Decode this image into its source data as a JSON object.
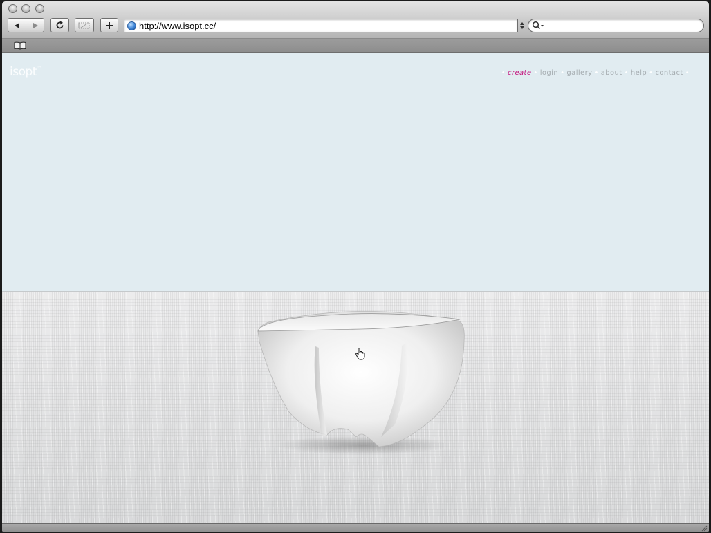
{
  "browser": {
    "url": "http://www.isopt.cc/",
    "icons": {
      "back": "back-arrow-icon",
      "forward": "forward-arrow-icon",
      "reload": "reload-icon",
      "snippet": "web-clip-icon",
      "add": "plus-icon",
      "search": "magnifier-icon",
      "bookmarks": "open-book-icon"
    }
  },
  "site": {
    "logo": "isopt",
    "logo_tm": "™",
    "nav": [
      {
        "label": "create",
        "active": true
      },
      {
        "label": "login",
        "active": false
      },
      {
        "label": "gallery",
        "active": false
      },
      {
        "label": "about",
        "active": false
      },
      {
        "label": "help",
        "active": false
      },
      {
        "label": "contact",
        "active": false
      }
    ],
    "colors": {
      "background": "#e1ecf1",
      "nav_active": "#c4157e",
      "nav_inactive": "#a5acb0",
      "logo": "#fbfdfe"
    }
  }
}
